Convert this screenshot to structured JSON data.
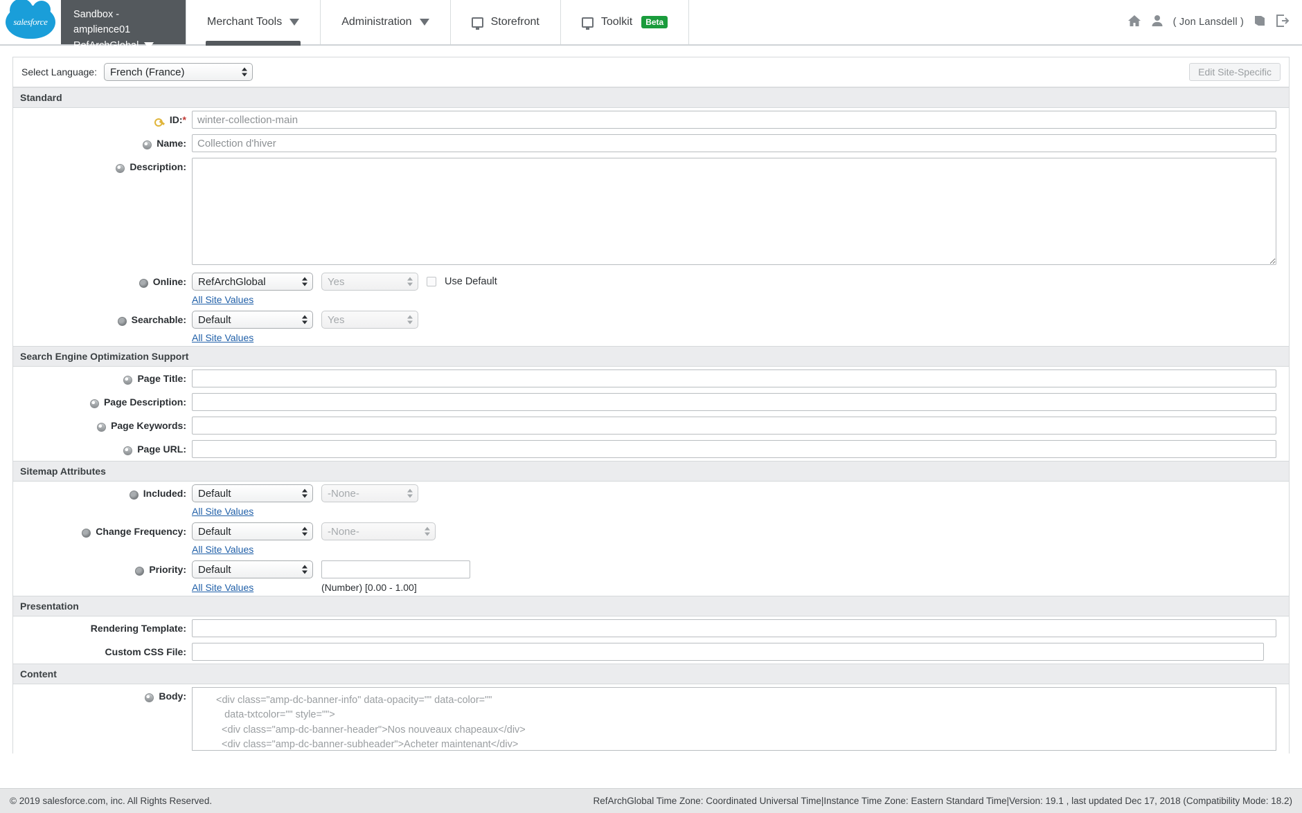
{
  "header": {
    "logo_text": "salesforce",
    "sandbox_line1": "Sandbox - amplience01",
    "sandbox_line2": "RefArchGlobal",
    "nav": [
      {
        "label": "Merchant Tools",
        "caret": true,
        "icon": null,
        "active": true
      },
      {
        "label": "Administration",
        "caret": true,
        "icon": null,
        "active": false
      },
      {
        "label": "Storefront",
        "caret": false,
        "icon": "monitor-icon",
        "active": false
      },
      {
        "label": "Toolkit",
        "caret": false,
        "icon": "monitor-icon",
        "badge": "Beta",
        "active": false
      }
    ],
    "user_name": "( Jon  Lansdell )",
    "icons": [
      "home-icon",
      "user-icon",
      "book-icon",
      "logout-icon"
    ]
  },
  "toolbar": {
    "select_language_label": "Select Language:",
    "language_value": "French (France)",
    "edit_site_specific_label": "Edit Site-Specific"
  },
  "sections": {
    "standard": {
      "title": "Standard",
      "id_label": "ID:",
      "id_required": "*",
      "id_value": "winter-collection-main",
      "name_label": "Name:",
      "name_value": "Collection d'hiver",
      "description_label": "Description:",
      "description_value": "",
      "online_label": "Online:",
      "online_site": "RefArchGlobal",
      "online_value": "Yes",
      "use_default_label": "Use Default",
      "all_site_values_label": "All Site Values",
      "searchable_label": "Searchable:",
      "searchable_site": "Default",
      "searchable_value": "Yes"
    },
    "seo": {
      "title": "Search Engine Optimization Support",
      "page_title_label": "Page Title:",
      "page_title_value": "",
      "page_description_label": "Page Description:",
      "page_description_value": "",
      "page_keywords_label": "Page Keywords:",
      "page_keywords_value": "",
      "page_url_label": "Page URL:",
      "page_url_value": ""
    },
    "sitemap": {
      "title": "Sitemap Attributes",
      "included_label": "Included:",
      "included_site": "Default",
      "included_value": "-None-",
      "change_frequency_label": "Change Frequency:",
      "change_frequency_site": "Default",
      "change_frequency_value": "-None-",
      "priority_label": "Priority:",
      "priority_site": "Default",
      "priority_value": "",
      "priority_hint": "(Number) [0.00 - 1.00]",
      "all_site_values_label": "All Site Values"
    },
    "presentation": {
      "title": "Presentation",
      "rendering_template_label": "Rendering Template:",
      "rendering_template_value": "",
      "custom_css_label": "Custom CSS File:",
      "custom_css_value": ""
    },
    "content": {
      "title": "Content",
      "body_label": "Body:",
      "body_lines": [
        "<div class=\"amp-dc-banner-info\" data-opacity=\"\" data-color=\"\"",
        "   data-txtcolor=\"\" style=\"\">",
        "  <div class=\"amp-dc-banner-header\">Nos nouveaux chapeaux</div>",
        "  <div class=\"amp-dc-banner-subheader\">Acheter maintenant</div>"
      ]
    }
  },
  "footer": {
    "copyright": "© 2019 salesforce.com, inc. All Rights Reserved.",
    "status": "RefArchGlobal Time Zone: Coordinated Universal Time|Instance Time Zone: Eastern Standard Time|Version: 19.1 , last updated Dec 17, 2018 (Compatibility Mode: 18.2)"
  },
  "colors": {
    "brand_blue": "#1a9ed9",
    "sandbox_gray": "#54595d",
    "beta_green": "#1a9c3c",
    "link_blue": "#1f5fa8",
    "required_red": "#c23934"
  }
}
